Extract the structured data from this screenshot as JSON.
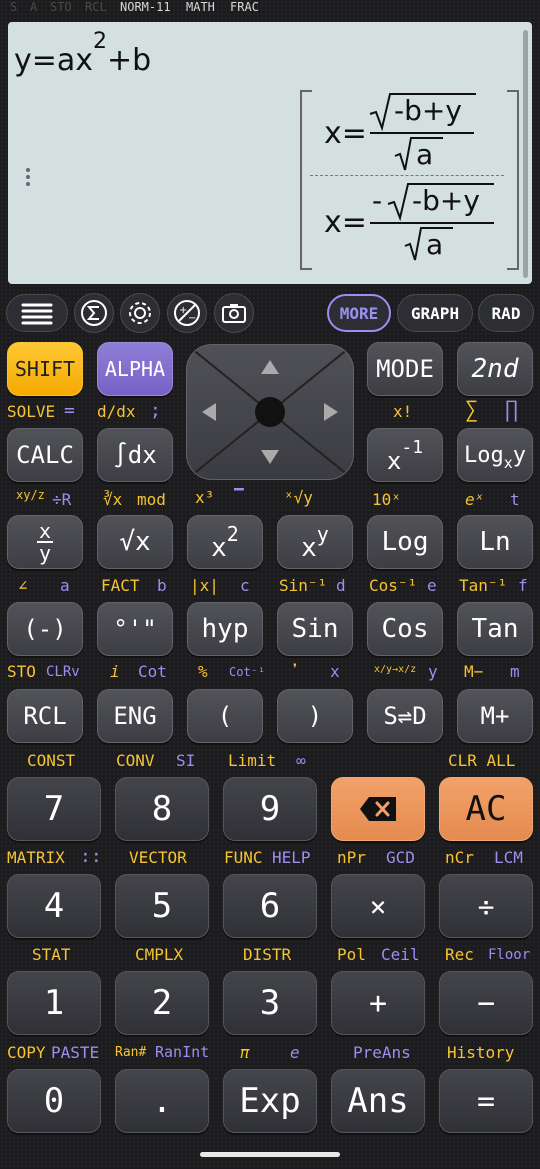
{
  "status_bar": {
    "s": "S",
    "a": "A",
    "sto": "STO",
    "rcl": "RCL",
    "mode": "NORM-11",
    "math": "MATH",
    "frac": "FRAC"
  },
  "display": {
    "input": {
      "y": "y",
      "eq": "=",
      "ax": "ax",
      "exp": "2",
      "plus_b": "+b"
    },
    "results": [
      {
        "lhs": "x",
        "eq": "=",
        "neg": "",
        "radicand": "-b+y",
        "denominator": "a"
      },
      {
        "lhs": "x",
        "eq": "=",
        "neg": "-",
        "radicand": "-b+y",
        "denominator": "a"
      }
    ]
  },
  "toolbar": {
    "menu_icon": "hamburger-icon",
    "sum_icon": "sigma-icon",
    "settings_icon": "gear-icon",
    "plusminus_icon": "plus-minus-icon",
    "camera_icon": "camera-icon",
    "more": "MORE",
    "graph": "GRAPH",
    "rad": "RAD"
  },
  "keys": {
    "shift": "SHIFT",
    "alpha": "ALPHA",
    "mode": "MODE",
    "second": "2nd",
    "calc": "CALC",
    "integral": "∫dx",
    "inverse": "x",
    "inverse_exp": "-1",
    "log_base": {
      "log": "Log",
      "sub": "x",
      "y": "y"
    },
    "frac": {
      "num": "x",
      "den": "y"
    },
    "sqrt": "√x",
    "square": "x",
    "square_exp": "2",
    "power": "x",
    "power_exp": "y",
    "log": "Log",
    "ln": "Ln",
    "neg": "(-)",
    "dms": "°'\"",
    "hyp": "hyp",
    "sin": "Sin",
    "cos": "Cos",
    "tan": "Tan",
    "rcl": "RCL",
    "eng": "ENG",
    "lparen": "(",
    "rparen": ")",
    "sd": "S⇌D",
    "mplus": "M+",
    "seven": "7",
    "eight": "8",
    "nine": "9",
    "del_icon": "backspace-icon",
    "ac": "AC",
    "four": "4",
    "five": "5",
    "six": "6",
    "mul": "×",
    "div": "÷",
    "one": "1",
    "two": "2",
    "three": "3",
    "add": "+",
    "sub": "−",
    "zero": "0",
    "dot": ".",
    "exp": "Exp",
    "ans": "Ans",
    "equals": "="
  },
  "labels": {
    "row1": {
      "solve": "SOLVE",
      "solve_eq": "=",
      "ddx": "d/dx",
      "ddx_sc": ";",
      "x_fact": "x!",
      "sigma": "∑",
      "pi": "∏"
    },
    "row2": {
      "xyfrac_y": "xy/z",
      "div_r": "÷R",
      "cuberoot": "∛x",
      "mod": "mod",
      "cube": "x³",
      "bar": "▔",
      "xroot": "ˣ√y",
      "ten_pow": "10ˣ",
      "e_pow": "eˣ",
      "t": "t"
    },
    "row3": {
      "angle": "∠",
      "a": "a",
      "fact": "FACT",
      "b": "b",
      "abs": "|x|",
      "c": "c",
      "asin": "Sin⁻¹",
      "d": "d",
      "acos": "Cos⁻¹",
      "e": "e",
      "atan": "Tan⁻¹",
      "f": "f"
    },
    "row4": {
      "sto": "STO",
      "clrv": "CLRv",
      "i": "i",
      "cot": "Cot",
      "percent": "%",
      "acot": "Cot⁻¹",
      "comma": "❜",
      "x": "x",
      "conv": "x/y→x/z",
      "y": "y",
      "mminus": "M−",
      "m": "m"
    },
    "row5": {
      "const": "CONST",
      "conv": "CONV",
      "si": "SI",
      "limit": "Limit",
      "inf": "∞",
      "clr_all": "CLR ALL"
    },
    "row6": {
      "matrix": "MATRIX",
      "matrix_icon": "::",
      "vector": "VECTOR",
      "func": "FUNC",
      "help": "HELP",
      "npr": "nPr",
      "gcd": "GCD",
      "ncr": "nCr",
      "lcm": "LCM"
    },
    "row7": {
      "stat": "STAT",
      "cmplx": "CMPLX",
      "distr": "DISTR",
      "pol": "Pol",
      "ceil": "Ceil",
      "rec": "Rec",
      "floor": "Floor"
    },
    "row8": {
      "copy": "COPY",
      "paste": "PASTE",
      "ran": "Ran#",
      "ranint": "RanInt",
      "pi": "π",
      "e": "e",
      "preans": "PreAns",
      "history": "History"
    }
  },
  "colors": {
    "yellow": "#f6c431",
    "purple": "#9c8ef2",
    "orange": "#e9935a",
    "display": "#d3e0df"
  }
}
